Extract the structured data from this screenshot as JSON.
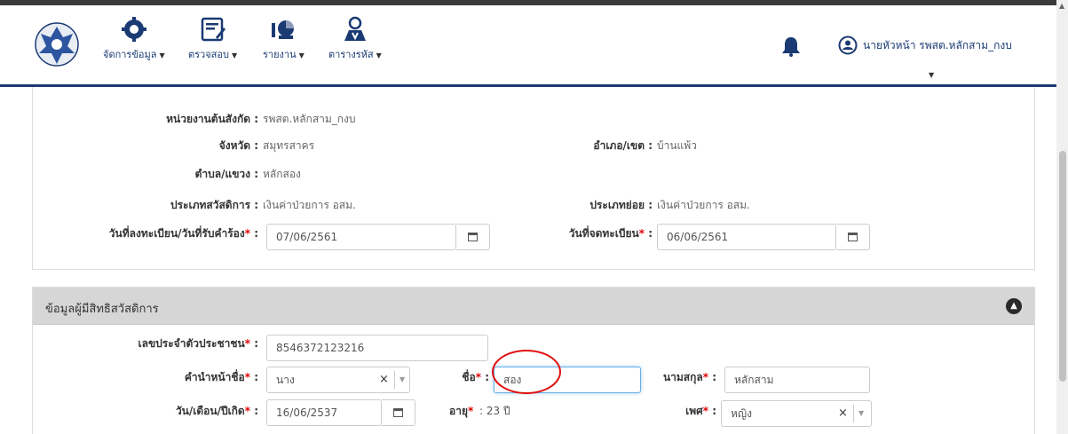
{
  "nav": {
    "items": [
      {
        "label": "จัดการข้อมูล",
        "icon": "gear-icon"
      },
      {
        "label": "ตรวจสอบ",
        "icon": "edit-document-icon"
      },
      {
        "label": "รายงาน",
        "icon": "report-icon"
      },
      {
        "label": "ตารางรหัส",
        "icon": "code-table-icon"
      }
    ],
    "user_name": "นายหัวหน้า รพสต.หลักสาม_กงบ"
  },
  "registration": {
    "unit_label": "หน่วยงานต้นสังกัด :",
    "unit_value": "รพสต.หลักสาม_กงบ",
    "province_label": "จังหวัด :",
    "province_value": "สมุทรสาคร",
    "district_label": "อำเภอ/เขต :",
    "district_value": "บ้านแพ้ว",
    "subdistrict_label": "ตำบล/แขวง :",
    "subdistrict_value": "หลักสอง",
    "welfare_type_label": "ประเภทสวัสดิการ :",
    "welfare_type_value": "เงินค่าป่วยการ อสม.",
    "subtype_label": "ประเภทย่อย :",
    "subtype_value": "เงินค่าป่วยการ อสม.",
    "regdate_label": "วันที่ลงทะเบียน/วันที่รับคำร้อง",
    "regdate_value": "07/06/2561",
    "signup_label": "วันที่จดทะเบียน",
    "signup_value": "06/06/2561"
  },
  "beneficiary": {
    "title": "ข้อมูลผู้มีสิทธิสวัสดิการ",
    "id_label": "เลขประจำตัวประชาชน",
    "id_value": "8546372123216",
    "prefix_label": "คำนำหน้าชื่อ",
    "prefix_value": "นาง",
    "name_label": "ชื่อ",
    "name_value": "สอง",
    "surname_label": "นามสกุล",
    "surname_value": "หลักสาม",
    "dob_label": "วัน/เดือน/ปีเกิด",
    "dob_value": "16/06/2537",
    "age_label": "อายุ",
    "age_value": ": 23 ปี",
    "sex_label": "เพศ",
    "sex_value": "หญิง"
  },
  "colors": {
    "nav_blue": "#1a3a73",
    "required": "#e00000",
    "highlight_circle": "#e01010"
  }
}
